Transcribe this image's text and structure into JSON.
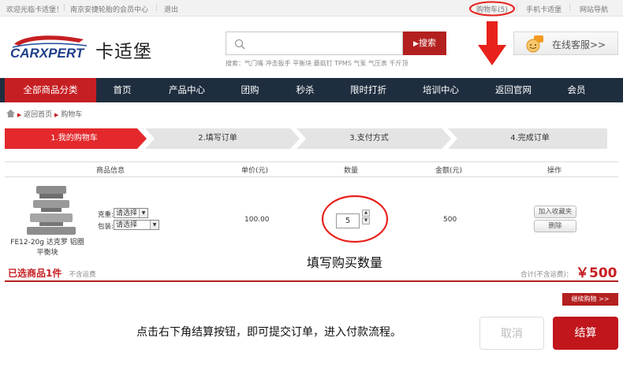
{
  "topbar": {
    "welcome": "欢迎光临卡适堡！",
    "member_center": "南京安捷轮胎的会员中心",
    "logout": "退出",
    "cart": "购物车(5)",
    "mobile": "手机卡适堡",
    "site_nav": "网站导航"
  },
  "header": {
    "logo_text": "CARXPERT",
    "brand_cn": "卡适堡",
    "search_placeholder": "",
    "search_button": "搜索",
    "hot_keywords": "搜索：气门嘴 冲击扳手 平衡块 蘑菇钉 TPMS 气泵 气压表 千斤顶",
    "customer_service": "在线客服>>"
  },
  "nav": {
    "items": [
      "全部商品分类",
      "首页",
      "产品中心",
      "团购",
      "秒杀",
      "限时打折",
      "培训中心",
      "返回官网",
      "会员"
    ]
  },
  "breadcrumb": {
    "home": "返回首页",
    "current": "购物车"
  },
  "steps": [
    "1.我的购物车",
    "2.填写订单",
    "3.支付方式",
    "4.完成订单"
  ],
  "table": {
    "headers": [
      "商品信息",
      "单价(元)",
      "数量",
      "金额(元)",
      "操作"
    ],
    "item": {
      "name": "FE12-20g 达克罗 铝圈 平衡块",
      "weight_label": "克重:",
      "weight_value": "请选择",
      "pack_label": "包装:",
      "pack_value": "请选择",
      "price": "100.00",
      "quantity": "5",
      "amount": "500",
      "fav_button": "加入收藏夹",
      "delete_button": "删除"
    }
  },
  "summary": {
    "selected": "已选商品1件",
    "no_freight": "不含运费",
    "total_label": "合计(不含运费)：",
    "total_value": "￥500"
  },
  "continue_shopping": "继续购物 >>",
  "annotations": {
    "quantity_hint": "填写购买数量",
    "checkout_hint": "点击右下角结算按钮，即可提交订单，进入付款流程。"
  },
  "buttons": {
    "cancel": "取消",
    "checkout": "结算"
  },
  "colors": {
    "accent": "#b3201f",
    "nav_bg": "#1f2e3f",
    "annotation_red": "#e8211c"
  }
}
